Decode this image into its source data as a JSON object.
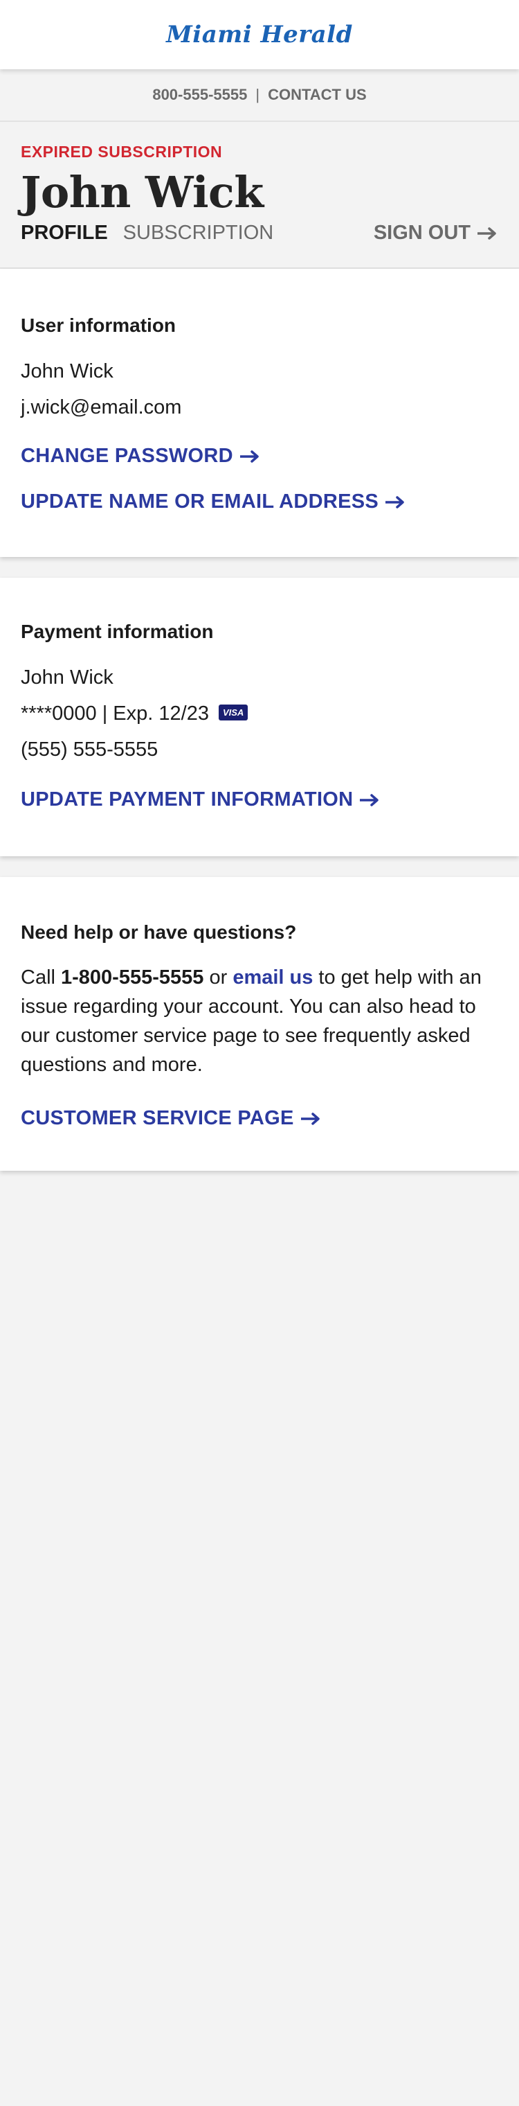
{
  "header": {
    "logo_text": "Miami Herald"
  },
  "contact_bar": {
    "phone": "800-555-5555",
    "separator": "|",
    "contact_label": "CONTACT US"
  },
  "account": {
    "status": "EXPIRED SUBSCRIPTION",
    "name": "John Wick",
    "tabs": [
      {
        "label": "PROFILE",
        "active": true
      },
      {
        "label": "SUBSCRIPTION",
        "active": false
      }
    ],
    "signout_label": "SIGN OUT"
  },
  "user_info": {
    "title": "User information",
    "name": "John Wick",
    "email": "j.wick@email.com",
    "change_password_label": "CHANGE PASSWORD",
    "update_name_email_label": "UPDATE NAME OR EMAIL ADDRESS"
  },
  "payment_info": {
    "title": "Payment information",
    "name": "John Wick",
    "card": "****0000 | Exp. 12/23",
    "card_brand": "VISA",
    "card_brand_color": "#1a1f71",
    "phone": "(555) 555-5555",
    "update_label": "UPDATE PAYMENT INFORMATION"
  },
  "help": {
    "title": "Need help or have questions?",
    "text_call": "Call ",
    "phone": "1-800-555-5555",
    "text_or": " or ",
    "email_link": "email us",
    "text_rest": " to get help with an issue regarding your account. You can also head to our customer service page to see frequently asked questions and more.",
    "service_link_label": "CUSTOMER SERVICE PAGE"
  },
  "icons": {
    "arrow": "arrow-right-icon"
  },
  "colors": {
    "brand_blue": "#1b63b5",
    "link_blue": "#2b3a9f",
    "alert_red": "#d22630",
    "page_bg": "#f3f3f3"
  }
}
